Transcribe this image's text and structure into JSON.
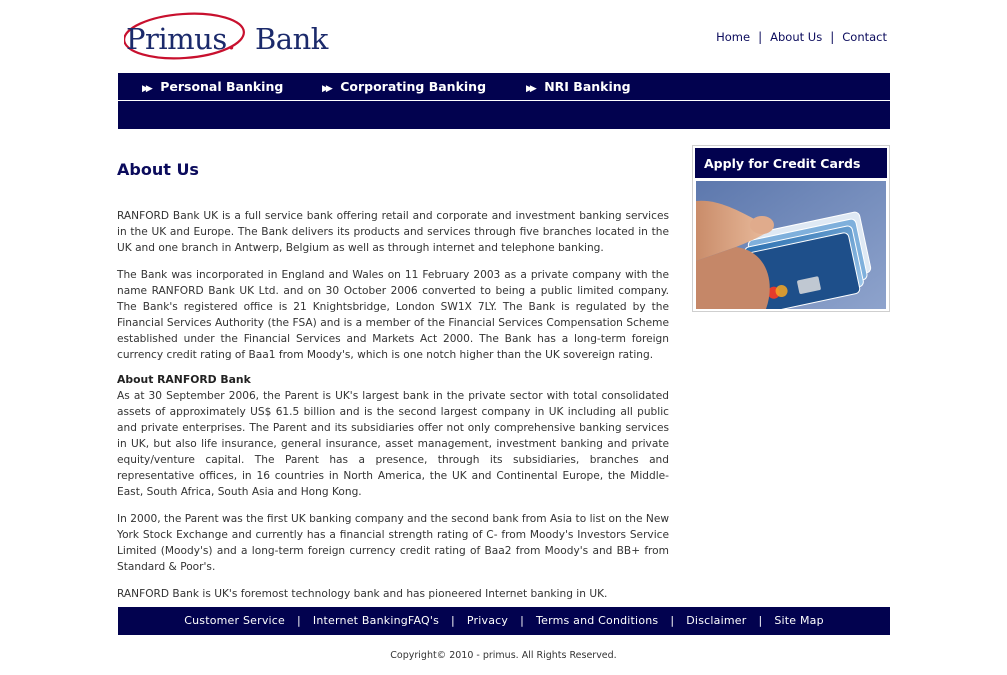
{
  "header": {
    "logo_word1": "Primus",
    "logo_dot": ".",
    "logo_word2": "Bank",
    "links": [
      "Home",
      "About Us",
      "Contact"
    ],
    "separator": "|"
  },
  "nav": {
    "items": [
      "Personal Banking",
      "Corporating Banking",
      "NRI Banking"
    ],
    "arrow_glyph": "▶▶"
  },
  "main": {
    "title": "About Us",
    "paragraph1": "RANFORD Bank UK is a full service bank offering retail and corporate and investment banking services in the UK and Europe. The Bank delivers its products and services through five branches located in the UK and one branch in Antwerp, Belgium as well as through internet and telephone banking.",
    "paragraph2": "The Bank was incorporated in England and Wales on 11 February 2003 as a private company with the name RANFORD Bank UK Ltd. and on 30 October 2006 converted to being a public limited company. The Bank's registered office is 21 Knightsbridge, London SW1X 7LY. The Bank is regulated by the Financial Services Authority (the FSA) and is a member of the Financial Services Compensation Scheme established under the Financial Services and Markets Act 2000. The Bank has a long-term foreign currency credit rating of Baa1 from Moody's, which is one notch higher than the UK sovereign rating.",
    "subheading": "About RANFORD Bank",
    "paragraph3": "As at 30 September 2006, the Parent is UK's largest bank in the private sector with total consolidated assets of approximately US$ 61.5 billion and is the second largest company in UK including all public and private enterprises. The Parent and its subsidiaries offer not only comprehensive banking services in UK, but also life insurance, general insurance, asset management, investment banking and private equity/venture capital. The Parent has a presence, through its subsidiaries, branches and representative offices, in 16 countries in North America, the UK and Continental Europe, the Middle-East, South Africa, South Asia and Hong Kong.",
    "paragraph4": "In 2000, the Parent was the first UK banking company and the second bank from Asia to list on the New York Stock Exchange and currently has a financial strength rating of C- from Moody's Investors Service Limited (Moody's) and a long-term foreign currency credit rating of Baa2 from Moody's and BB+ from Standard & Poor's.",
    "paragraph5": "RANFORD Bank is UK's foremost technology bank and has pioneered Internet banking in UK."
  },
  "sidebar": {
    "title": "Apply for Credit Cards"
  },
  "footer": {
    "links": [
      "Customer Service",
      "Internet BankingFAQ's",
      "Privacy",
      "Terms and Conditions",
      "Disclaimer",
      "Site Map"
    ],
    "separator": "|",
    "copyright": "Copyright© 2010 - primus. All Rights Reserved."
  },
  "colors": {
    "navy": "#02024f",
    "logo_blue": "#1b2a6b",
    "logo_red": "#c8102e"
  }
}
